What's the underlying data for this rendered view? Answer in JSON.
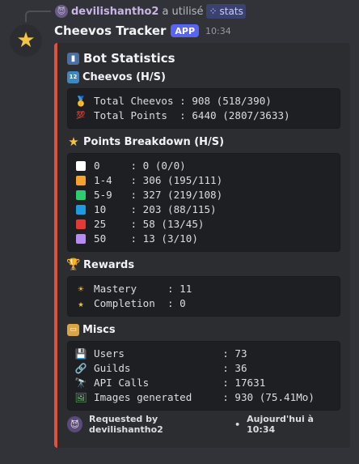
{
  "reply": {
    "username": "devilishantho2",
    "action": "a utilisé",
    "command": "stats"
  },
  "message": {
    "bot_name": "Cheevos Tracker",
    "badge": "APP",
    "time": "10:34"
  },
  "embed": {
    "accent_color": "#e0533a",
    "title": "Bot Statistics",
    "title_icon": "bar-chart-emoji",
    "sections": {
      "cheevos": {
        "title": "Cheevos (H/S)",
        "icon": "1234-emoji",
        "rows": [
          {
            "icon": "medal-emoji",
            "text": "Total Cheevos : 908 (518/390)"
          },
          {
            "icon": "100-emoji",
            "text": "Total Points  : 6440 (2807/3633)"
          }
        ]
      },
      "points": {
        "title": "Points Breakdown (H/S)",
        "icon": "star-emoji",
        "rows": [
          {
            "color": "#ffffff",
            "text": "0     : 0 (0/0)"
          },
          {
            "color": "#f7a22a",
            "text": "1-4   : 306 (195/111)"
          },
          {
            "color": "#2ecc71",
            "text": "5-9   : 327 (219/108)"
          },
          {
            "color": "#1e9ae0",
            "text": "10    : 203 (88/115)"
          },
          {
            "color": "#e53935",
            "text": "25    : 58 (13/45)"
          },
          {
            "color": "#b68cf0",
            "text": "50    : 13 (3/10)"
          }
        ]
      },
      "rewards": {
        "title": "Rewards",
        "icon": "trophy-emoji",
        "rows": [
          {
            "icon": "sun-emoji",
            "text": "Mastery     : 11"
          },
          {
            "icon": "star-emoji",
            "text": "Completion  : 0"
          }
        ]
      },
      "miscs": {
        "title": "Miscs",
        "icon": "card-box-emoji",
        "rows": [
          {
            "icon": "floppy-disk-emoji",
            "text": "Users                : 73"
          },
          {
            "icon": "link-emoji",
            "text": "Guilds               : 36"
          },
          {
            "icon": "telescope-emoji",
            "text": "API Calls            : 17631"
          },
          {
            "icon": "picture-emoji",
            "text": "Images generated     : 930 (75.41Mo)"
          }
        ]
      }
    },
    "footer": {
      "requested_by": "Requested by devilishantho2",
      "separator": "•",
      "when": "Aujourd'hui à 10:34"
    }
  }
}
